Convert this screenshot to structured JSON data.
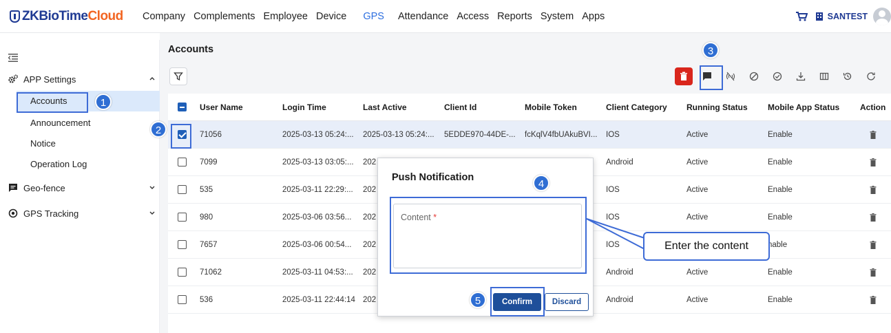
{
  "brand": {
    "name_part1": "ZKBioTime",
    "name_part2": "Cloud"
  },
  "nav": [
    "Company",
    "Complements",
    "Employee",
    "Device",
    "GPS",
    "Attendance",
    "Access",
    "Reports",
    "System",
    "Apps"
  ],
  "nav_active": "GPS",
  "header": {
    "user": "SANTEST"
  },
  "sidebar": {
    "app_settings": "APP Settings",
    "items": [
      "Accounts",
      "Announcement",
      "Notice",
      "Operation Log"
    ],
    "geo_fence": "Geo-fence",
    "gps_tracking": "GPS Tracking"
  },
  "page": {
    "title": "Accounts"
  },
  "table": {
    "columns": [
      "User Name",
      "Login Time",
      "Last Active",
      "Client Id",
      "Mobile Token",
      "Client Category",
      "Running Status",
      "Mobile App Status",
      "Action"
    ],
    "rows": [
      {
        "user": "71056",
        "login": "2025-03-13 05:24:...",
        "last": "2025-03-13 05:24:...",
        "client_id": "5EDDE970-44DE-...",
        "token": "fcKqlV4fbUAkuBVI...",
        "category": "IOS",
        "running": "Active",
        "app_status": "Enable",
        "selected": true
      },
      {
        "user": "7099",
        "login": "2025-03-13 03:05:...",
        "last": "202",
        "client_id": "",
        "token": "",
        "category": "Android",
        "running": "Active",
        "app_status": "Enable",
        "selected": false
      },
      {
        "user": "535",
        "login": "2025-03-11 22:29:...",
        "last": "202",
        "client_id": "",
        "token": "",
        "category": "IOS",
        "running": "Active",
        "app_status": "Enable",
        "selected": false
      },
      {
        "user": "980",
        "login": "2025-03-06 03:56...",
        "last": "202",
        "client_id": "",
        "token": "",
        "category": "IOS",
        "running": "Active",
        "app_status": "Enable",
        "selected": false
      },
      {
        "user": "7657",
        "login": "2025-03-06 00:54...",
        "last": "202",
        "client_id": "",
        "token": "",
        "category": "IOS",
        "running": "Active",
        "app_status": "nable",
        "selected": false
      },
      {
        "user": "71062",
        "login": "2025-03-11 04:53:...",
        "last": "202",
        "client_id": "",
        "token": "",
        "category": "Android",
        "running": "Active",
        "app_status": "Enable",
        "selected": false
      },
      {
        "user": "536",
        "login": "2025-03-11 22:44:14",
        "last": "202",
        "client_id": "",
        "token": "",
        "category": "Android",
        "running": "Active",
        "app_status": "Enable",
        "selected": false
      }
    ]
  },
  "modal": {
    "title": "Push Notification",
    "content_label": "Content",
    "required_mark": "*",
    "confirm": "Confirm",
    "discard": "Discard"
  },
  "annotations": {
    "badges": [
      "1",
      "2",
      "3",
      "4",
      "5"
    ],
    "callout": "Enter the content"
  },
  "colors": {
    "accent": "#2d6fe0",
    "brand_blue": "#1f3a93",
    "brand_orange": "#f26522",
    "delete_red": "#d9261c",
    "annotation_blue": "#3d6bd6"
  }
}
